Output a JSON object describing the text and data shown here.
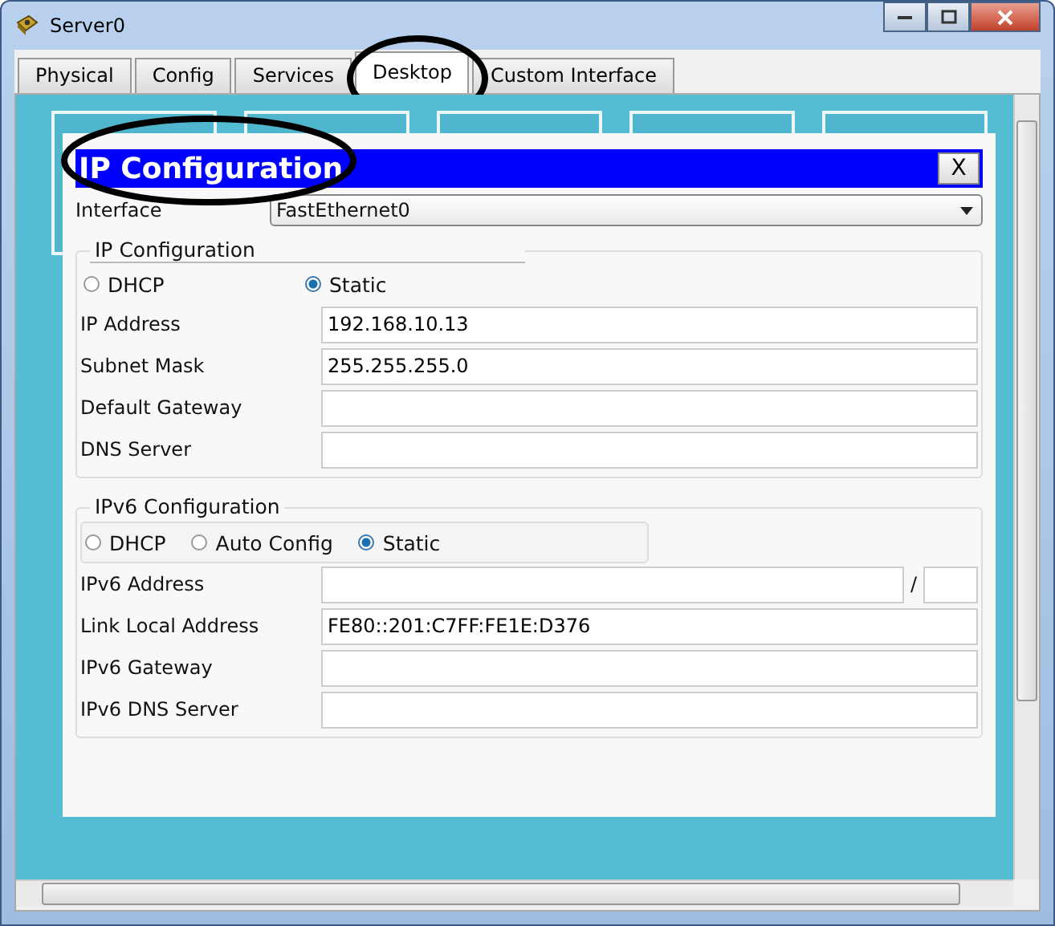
{
  "window": {
    "title": "Server0"
  },
  "tabs": [
    {
      "label": "Physical",
      "selected": false
    },
    {
      "label": "Config",
      "selected": false
    },
    {
      "label": "Services",
      "selected": false
    },
    {
      "label": "Desktop",
      "selected": true
    },
    {
      "label": "Custom Interface",
      "selected": false
    }
  ],
  "dialog": {
    "title": "IP Configuration",
    "close": "X",
    "interface": {
      "label": "Interface",
      "value": "FastEthernet0"
    },
    "ipv4": {
      "legend": "IP Configuration",
      "modes": [
        {
          "label": "DHCP",
          "selected": false
        },
        {
          "label": "Static",
          "selected": true
        }
      ],
      "fields": [
        {
          "label": "IP Address",
          "value": "192.168.10.13"
        },
        {
          "label": "Subnet Mask",
          "value": "255.255.255.0"
        },
        {
          "label": "Default Gateway"
        },
        {
          "label": "DNS Server"
        }
      ]
    },
    "ipv6": {
      "legend": "IPv6 Configuration",
      "modes": [
        {
          "label": "DHCP",
          "selected": false
        },
        {
          "label": "Auto Config",
          "selected": false
        },
        {
          "label": "Static",
          "selected": true
        }
      ],
      "fields": [
        {
          "label": "IPv6 Address",
          "kind": "prefixed",
          "separator": "/"
        },
        {
          "label": "Link Local Address",
          "kind": "plain",
          "value": "FE80::201:C7FF:FE1E:D376"
        },
        {
          "label": "IPv6 Gateway",
          "kind": "plain"
        },
        {
          "label": "IPv6 DNS Server",
          "kind": "plain"
        }
      ]
    }
  }
}
